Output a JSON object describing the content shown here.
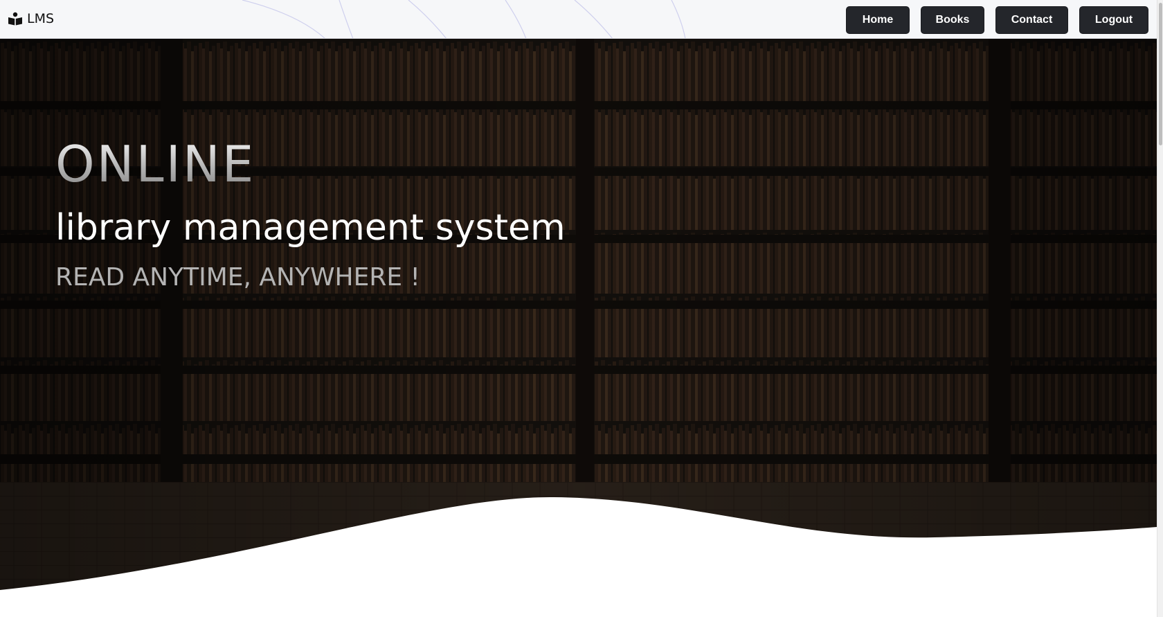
{
  "navbar": {
    "brand": "LMS",
    "buttons": {
      "home": "Home",
      "books": "Books",
      "contact": "Contact",
      "logout": "Logout"
    }
  },
  "hero": {
    "title": "ONLINE",
    "subtitle": "library management system",
    "tagline": "READ ANYTIME, ANYWHERE !"
  },
  "icons": {
    "brand": "book-reader-icon"
  },
  "colors": {
    "navbar_bg": "#f6f7f9",
    "button_bg": "#24262b",
    "button_text": "#ffffff",
    "hero_overlay": "#1d1814",
    "subtitle_text": "#ffffff",
    "tagline_text": "#b4b4b4"
  }
}
